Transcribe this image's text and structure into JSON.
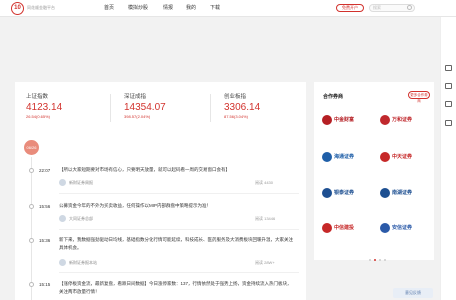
{
  "header": {
    "logo_text": "10",
    "brand": "同花顺金融平台",
    "nav": [
      "首页",
      "模拟炒股",
      "情报",
      "我的",
      "下载"
    ],
    "open_account": "免费开户",
    "search_placeholder": "搜索"
  },
  "indices": [
    {
      "name": "上证指数",
      "value": "4123.14",
      "change": "26.54(0.65%)"
    },
    {
      "name": "深证成指",
      "value": "14354.07",
      "change": "398.57(2.04%)"
    },
    {
      "name": "创业板指",
      "value": "3306.14",
      "change": "87.56(3.04%)"
    }
  ],
  "date_badge": "06/26",
  "feed": [
    {
      "time": "22:07",
      "text": "【所以大家短期要对市场有信心，只要明天放量，就可以起码看一周的交易窗口会有】",
      "source": "新财证券周报",
      "read": "阅读 4430"
    },
    {
      "time": "15:56",
      "text": "公募资金今年的不外为买卖收益，任何操作以MIP内部群盘中策略提示为准！",
      "source": "大同证券总部",
      "read": "阅读 13446"
    },
    {
      "time": "15:36",
      "text": "新下来，我数据强劲驱动日均线，基础指数分化行情可能延续，科技成长、医药服务及大消费板块回暖升温，大家关注具体机会。",
      "source": "新财证券报本站",
      "read": "阅读 28W+"
    },
    {
      "time": "15:15",
      "text": "【涨停板资金流，最新复盘，看跌日间数据】今日涨停家数：137，行情依然处于强势上扬，资金持续流入热门板块，关注两市放量行情！",
      "source": "",
      "read": ""
    }
  ],
  "partners": {
    "title": "合作券商",
    "more": "更多合作券商",
    "brokers": [
      {
        "name": "中金财富",
        "color": "#b51f24"
      },
      {
        "name": "万和证券",
        "color": "#c0282d"
      },
      {
        "name": "海通证券",
        "color": "#1f5fa8"
      },
      {
        "name": "中天证券",
        "color": "#c62828"
      },
      {
        "name": "银泰证券",
        "color": "#1d4f91"
      },
      {
        "name": "南湖证券",
        "color": "#1d4f91"
      },
      {
        "name": "中信建投",
        "color": "#c62828"
      },
      {
        "name": "安信证券",
        "color": "#2b5aa8"
      }
    ]
  },
  "footer_button": "意见反馈"
}
